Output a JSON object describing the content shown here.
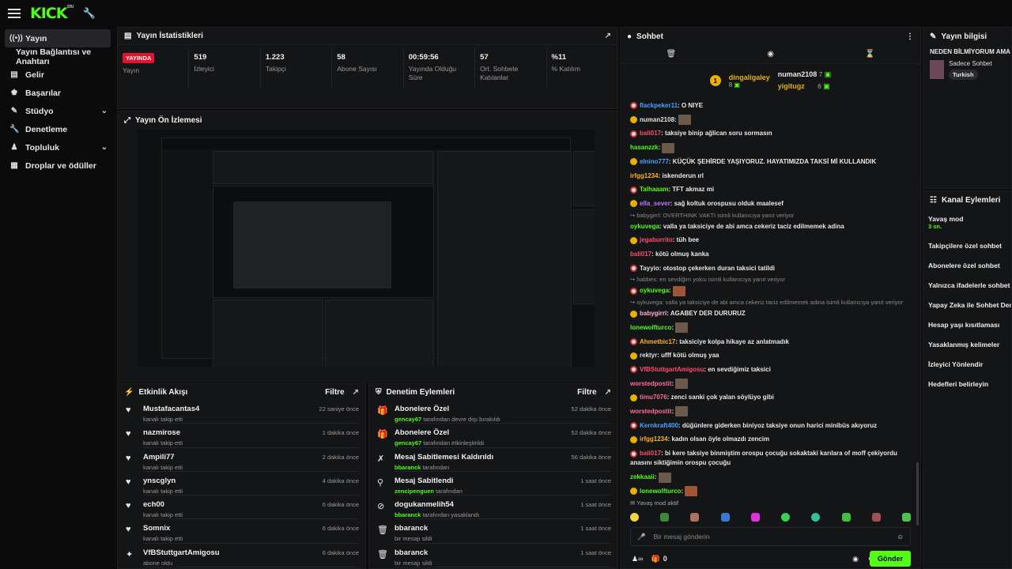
{
  "topbar": {
    "logo": "KICK",
    "logo_sup": "STU"
  },
  "sidebar": {
    "items": [
      {
        "label": "Yayın",
        "icon": "broadcast-icon"
      },
      {
        "label": "Yayın Bağlantısı ve Anahtarı"
      },
      {
        "label": "Gelir",
        "icon": "chart-icon"
      },
      {
        "label": "Başarılar",
        "icon": "trophy-icon"
      },
      {
        "label": "Stüdyo",
        "icon": "brush-icon"
      },
      {
        "label": "Denetleme",
        "icon": "wrench-icon"
      },
      {
        "label": "Topluluk",
        "icon": "community-icon"
      },
      {
        "label": "Droplar ve ödüller",
        "icon": "drops-icon"
      }
    ]
  },
  "stats": {
    "title": "Yayın İstatistikleri",
    "items": [
      {
        "value": "YAYINDA",
        "label": "Yayın"
      },
      {
        "value": "519",
        "label": "İzleyici"
      },
      {
        "value": "1.223",
        "label": "Takipçi"
      },
      {
        "value": "58",
        "label": "Abone Sayısı"
      },
      {
        "value": "00:59:56",
        "label": "Yayında Olduğu Süre"
      },
      {
        "value": "57",
        "label": "Ort. Sohbete Katılanlar"
      },
      {
        "value": "%11",
        "label": "% Katılım"
      }
    ]
  },
  "preview": {
    "title": "Yayın Ön İzlemesi"
  },
  "activity": {
    "title": "Etkinlik Akışı",
    "filter": "Filtre",
    "rows": [
      {
        "name": "Mustafacantas4",
        "sub": "kanalı takip etti",
        "time": "22 saniye önce"
      },
      {
        "name": "nazmirose",
        "sub": "kanalı takip etti",
        "time": "1 dakika önce"
      },
      {
        "name": "Ampili77",
        "sub": "kanalı takip etti",
        "time": "2 dakika önce"
      },
      {
        "name": "ynscglyn",
        "sub": "kanalı takip etti",
        "time": "4 dakika önce"
      },
      {
        "name": "ech00",
        "sub": "kanalı takip etti",
        "time": "6 dakika önce"
      },
      {
        "name": "Somnix",
        "sub": "kanalı takip etti",
        "time": "6 dakika önce"
      },
      {
        "name": "VfBStuttgartAmigosu",
        "sub": "abone oldu",
        "time": "6 dakika önce"
      }
    ]
  },
  "moderation": {
    "title": "Denetim Eylemleri",
    "filter": "Filtre",
    "rows": [
      {
        "name": "Abonelere Özel",
        "user": "gencay67",
        "sub": " tarafından devre dışı bırakıldı",
        "time": "52 dakika önce"
      },
      {
        "name": "Abonelere Özel",
        "user": "gencay67",
        "sub": " tarafından etkinleştirildi",
        "time": "52 dakika önce"
      },
      {
        "name": "Mesaj Sabitlemesi Kaldırıldı",
        "user": "bbaranck",
        "sub": " tarafından",
        "time": "56 dakika önce"
      },
      {
        "name": "Mesaj Sabitlendi",
        "user": "zencipenguen",
        "sub": " tarafından",
        "time": "1 saat önce"
      },
      {
        "name": "dogukanmelih54",
        "user": "bbaranck",
        "sub": " tarafından yasaklandı",
        "time": "1 saat önce"
      },
      {
        "name": "bbaranck",
        "user": "",
        "sub": "bir mesajı sildi",
        "time": "1 saat önce"
      },
      {
        "name": "bbaranck",
        "user": "",
        "sub": "bir mesajı sildi",
        "time": "1 saat önce"
      }
    ]
  },
  "chat": {
    "title": "Sohbet",
    "gifters": [
      {
        "name": "dingaligaley",
        "count": "8"
      },
      {
        "name": "numan2108",
        "count": "7"
      },
      {
        "name": "yigitugz",
        "count": "6"
      }
    ],
    "slow_mode": "Yavaş mod aktif",
    "input_placeholder": "Bir mesaj gönderin",
    "viewer_count": "0",
    "send": "Gönder",
    "messages": [
      {
        "user": "flackpeker11",
        "color": "#4aa3ff",
        "text": "O NIYE"
      },
      {
        "user": "numan2108",
        "color": "#e0e0e0",
        "text": ""
      },
      {
        "user": "bali017",
        "color": "#ff4d6d",
        "text": "taksiye binip ağlican soru sormasın"
      },
      {
        "user": "hasanzzk",
        "color": "#53fc18",
        "text": ""
      },
      {
        "user": "elnino777",
        "color": "#4aa3ff",
        "text": "KÜÇÜK ŞEHİRDE YAŞIYORUZ. HAYATIMIZDA TAKSİ Mİ KULLANDIK"
      },
      {
        "user": "irfgg1234",
        "color": "#ffb020",
        "text": "iskenderun ırl"
      },
      {
        "user": "Talhaaam",
        "color": "#53fc18",
        "text": "TFT akmaz mi"
      },
      {
        "user": "ella_sever",
        "color": "#b57bff",
        "text": "sağ koltuk orospusu olduk maalesef"
      },
      {
        "reply": "babygirrl: OVERTHINK VAKTI isimli kullanıcıya yanıt veriyor"
      },
      {
        "user": "oykuvega",
        "color": "#53fc18",
        "text": "valla ya taksiciye de abi amca cekeriz taciz edilmemek adina"
      },
      {
        "user": "jegaburrito",
        "color": "#ff4d6d",
        "text": "tüh bee"
      },
      {
        "user": "bali017",
        "color": "#ff4d6d",
        "text": "kötü olmuş kanka"
      },
      {
        "user": "Tayyio",
        "color": "#e0e0e0",
        "text": "otostop çekerken duran taksici tatildi"
      },
      {
        "reply": "habbes: en sevdiğim yolcu isimli kullanıcıya yanıt veriyor"
      },
      {
        "user": "oykuvega",
        "color": "#53fc18",
        "text": ""
      },
      {
        "reply": "oykuvega: valla ya taksiciye de abi amca cekeriz taciz edilmemek adina isimli kullanıcıya yanıt veriyor"
      },
      {
        "user": "babygirrl",
        "color": "#ffb0d0",
        "text": "AGABEY DER DURURUZ"
      },
      {
        "user": "lonewolfturco",
        "color": "#53fc18",
        "text": ""
      },
      {
        "user": "Ahmetbic17",
        "color": "#ffb020",
        "text": "taksiciye kolpa hikaye az anlatmadık"
      },
      {
        "user": "rektyr",
        "color": "#e0e0e0",
        "text": "ufff kötü olmuş yaa"
      },
      {
        "user": "VfBStuttgartAmigosu",
        "color": "#ff4d6d",
        "text": "en sevdiğimiz taksici"
      },
      {
        "user": "worstedpostit",
        "color": "#ff6b9a",
        "text": ""
      },
      {
        "user": "timu7076",
        "color": "#ff6b9a",
        "text": "zenci sanki çok yalan söylüyo gibi"
      },
      {
        "user": "worstedpostit",
        "color": "#ff6b9a",
        "text": ""
      },
      {
        "user": "Kernkraft400",
        "color": "#4aa3ff",
        "text": "düğünlere giderken biniyoz taksiye onun harici minibüs akıyoruz"
      },
      {
        "user": "irfgg1234",
        "color": "#ffb020",
        "text": "kadın olsan öyle olmazdı zencim"
      },
      {
        "user": "bali017",
        "color": "#ff4d6d",
        "text": "bi kere taksiye binmiştim orospu çocuğu sokaktaki karılara of moff çekiyordu anasını siktiğimin orospu çocuğu"
      },
      {
        "user": "zekkaaii",
        "color": "#53fc18",
        "text": ""
      },
      {
        "user": "lonewolfturco",
        "color": "#53fc18",
        "text": ""
      }
    ]
  },
  "stream_info": {
    "title": "Yayın bilgisi",
    "stream_title": "NEDEN BİLMİYORUM AMA",
    "category": "Sadece Sohbet",
    "tag": "Turkish"
  },
  "channel_actions": {
    "title": "Kanal Eylemleri",
    "items": [
      {
        "label": "Yavaş mod",
        "sub": "3 sn."
      },
      {
        "label": "Takipçilere özel sohbet"
      },
      {
        "label": "Abonelere özel sohbet"
      },
      {
        "label": "Yalnızca ifadelerle sohbet"
      },
      {
        "label": "Yapay Zeka ile Sohbet Denetimi"
      },
      {
        "label": "Hesap yaşı kısıtlaması"
      },
      {
        "label": "Yasaklanmış kelimeler"
      },
      {
        "label": "İzleyici Yönlendir"
      },
      {
        "label": "Hedefleri belirleyin"
      }
    ]
  }
}
